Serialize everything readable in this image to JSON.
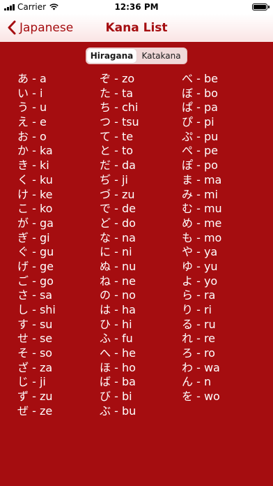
{
  "status_bar": {
    "carrier": "Carrier",
    "time": "12:36 PM"
  },
  "nav": {
    "back_label": "Japanese",
    "title": "Kana List"
  },
  "segments": [
    {
      "label": "Hiragana",
      "selected": true
    },
    {
      "label": "Katakana",
      "selected": false
    }
  ],
  "colors": {
    "background": "#a50d10",
    "accent": "#a50d10"
  },
  "columns": [
    [
      "あ - a",
      "い - i",
      "う - u",
      "え - e",
      "お - o",
      "か - ka",
      "き - ki",
      "く - ku",
      "け - ke",
      "こ - ko",
      "が - ga",
      "ぎ - gi",
      "ぐ - gu",
      "げ - ge",
      "ご - go",
      "さ - sa",
      "し - shi",
      "す - su",
      "せ - se",
      "そ - so",
      "ざ - za",
      "じ - ji",
      "ず - zu",
      "ぜ - ze"
    ],
    [
      "ぞ - zo",
      "た - ta",
      "ち - chi",
      "つ - tsu",
      "て - te",
      "と - to",
      "だ - da",
      "ぢ - ji",
      "づ - zu",
      "で - de",
      "ど - do",
      "な - na",
      "に - ni",
      "ぬ - nu",
      "ね - ne",
      "の - no",
      "は - ha",
      "ひ - hi",
      "ふ - fu",
      "へ - he",
      "ほ - ho",
      "ば - ba",
      "び - bi",
      "ぶ - bu"
    ],
    [
      "べ - be",
      "ぼ - bo",
      "ぱ - pa",
      "ぴ - pi",
      "ぷ - pu",
      "ぺ - pe",
      "ぽ - po",
      "ま - ma",
      "み - mi",
      "む - mu",
      "め - me",
      "も - mo",
      "や - ya",
      "ゆ - yu",
      "よ - yo",
      "ら - ra",
      "り - ri",
      "る - ru",
      "れ - re",
      "ろ - ro",
      "わ - wa",
      "ん - n",
      "を - wo"
    ]
  ]
}
